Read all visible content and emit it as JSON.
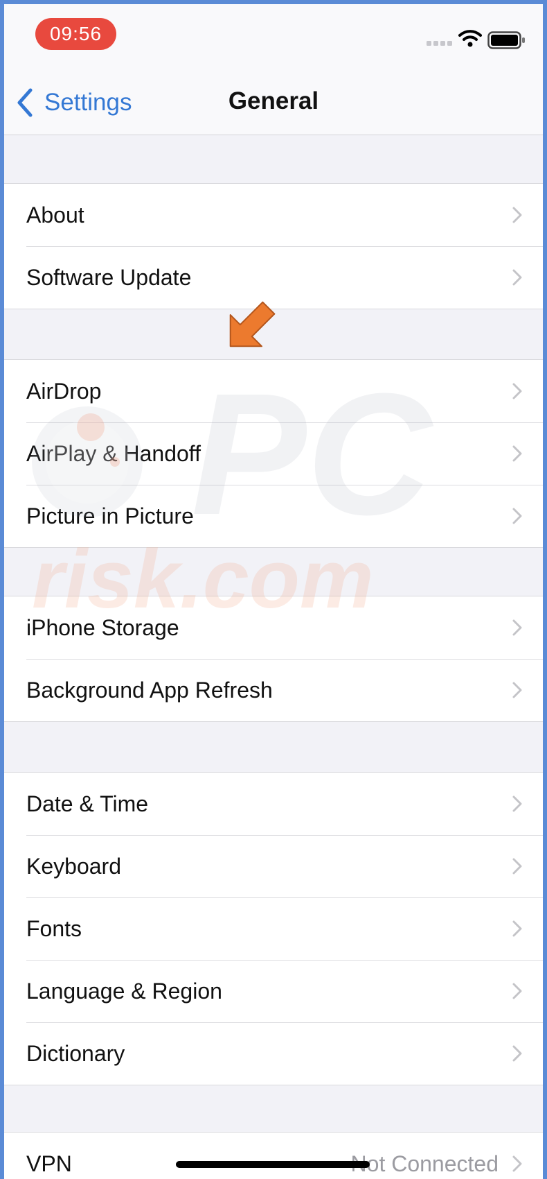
{
  "status_bar": {
    "time": "09:56",
    "icons": [
      "cellular-signal-icon",
      "wifi-icon",
      "battery-icon"
    ]
  },
  "nav": {
    "back_label": "Settings",
    "title": "General"
  },
  "groups": [
    {
      "rows": [
        {
          "label": "About"
        },
        {
          "label": "Software Update"
        }
      ]
    },
    {
      "rows": [
        {
          "label": "AirDrop"
        },
        {
          "label": "AirPlay & Handoff"
        },
        {
          "label": "Picture in Picture"
        }
      ]
    },
    {
      "rows": [
        {
          "label": "iPhone Storage"
        },
        {
          "label": "Background App Refresh"
        }
      ]
    },
    {
      "rows": [
        {
          "label": "Date & Time"
        },
        {
          "label": "Keyboard"
        },
        {
          "label": "Fonts"
        },
        {
          "label": "Language & Region"
        },
        {
          "label": "Dictionary"
        }
      ]
    },
    {
      "rows": [
        {
          "label": "VPN",
          "value": "Not Connected"
        }
      ]
    }
  ],
  "watermark": {
    "text_top": "PC",
    "text_bottom": "risk.com"
  },
  "colors": {
    "accent": "#3478d4",
    "time_pill": "#e8493e",
    "pointer_arrow": "#ec7a2e",
    "frame": "#5b8bd6"
  }
}
